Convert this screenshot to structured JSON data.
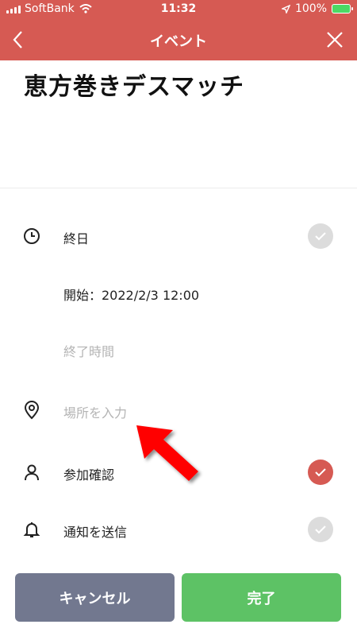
{
  "status_bar": {
    "carrier": "SoftBank",
    "time": "11:32",
    "battery": "100%",
    "icons": [
      "signal-icon",
      "wifi-icon",
      "location-icon",
      "battery-icon"
    ]
  },
  "nav": {
    "title": "イベント",
    "back_icon": "chevron-left-icon",
    "close_icon": "close-icon"
  },
  "event": {
    "title": "恵方巻きデスマッチ"
  },
  "rows": {
    "all_day": {
      "label": "終日",
      "checked": false,
      "icon": "clock-icon"
    },
    "start": {
      "label": "開始：2022/2/3 12:00"
    },
    "end": {
      "placeholder": "終了時間"
    },
    "location": {
      "placeholder": "場所を入力",
      "icon": "location-pin-icon"
    },
    "rsvp": {
      "label": "参加確認",
      "checked": true,
      "icon": "person-icon"
    },
    "notify": {
      "label": "通知を送信",
      "checked": false,
      "icon": "bell-icon"
    }
  },
  "buttons": {
    "cancel": "キャンセル",
    "done": "完了"
  },
  "colors": {
    "header": "#d65a53",
    "check_on": "#d65a53",
    "check_off": "#dcdcdc",
    "cancel_button": "#72788f",
    "done_button": "#5dc265",
    "annotation_arrow": "#ff0000"
  }
}
